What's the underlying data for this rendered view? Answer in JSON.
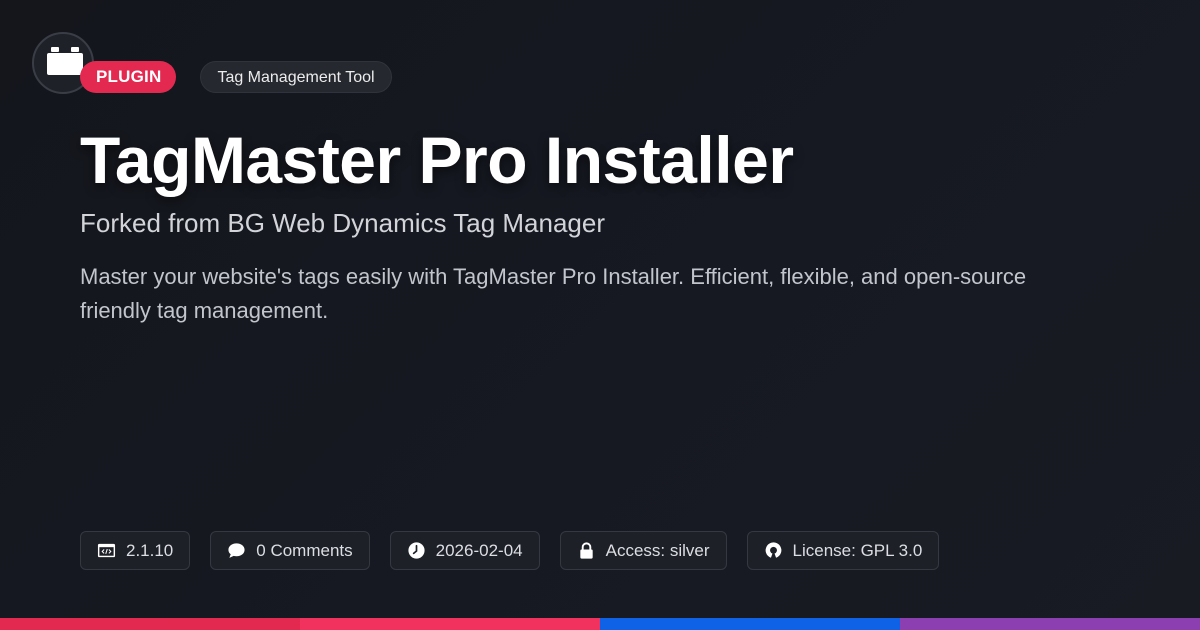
{
  "badges": {
    "type_label": "PLUGIN",
    "category_label": "Tag Management Tool"
  },
  "title": "TagMaster Pro Installer",
  "subtitle": "Forked from BG Web Dynamics Tag Manager",
  "description": "Master your website's tags easily with TagMaster Pro Installer. Efficient, flexible, and open-source friendly tag management.",
  "meta": {
    "version": "2.1.10",
    "comments": "0 Comments",
    "date": "2026-02-04",
    "access": "Access: silver",
    "license": "License: GPL 3.0"
  },
  "icons": {
    "logo": "plugin-block-icon",
    "version": "code-window-icon",
    "comments": "speech-bubble-icon",
    "date": "clock-icon",
    "access": "lock-icon",
    "license": "open-source-icon"
  },
  "colors": {
    "background": "#16181f",
    "accent": "#e3294f",
    "bottom_bar": [
      "#e3294f",
      "#f2325e",
      "#0f62e6",
      "#8b3fb1"
    ]
  }
}
